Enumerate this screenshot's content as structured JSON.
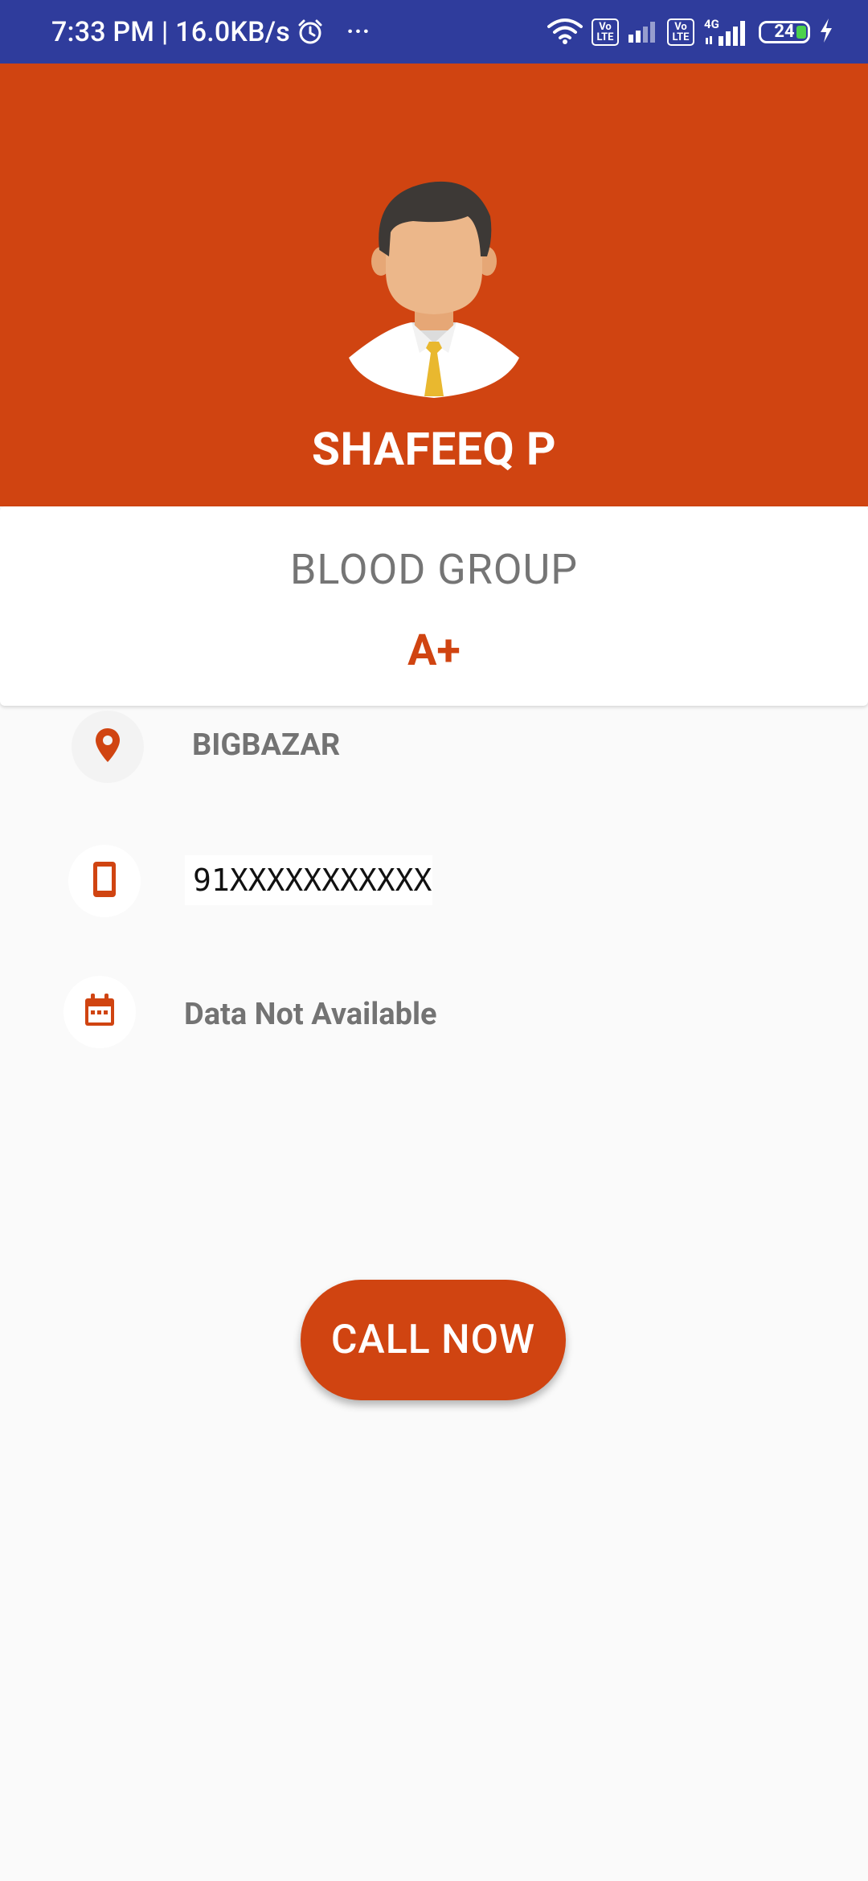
{
  "status_bar": {
    "time_speed": "7:33 PM | 16.0KB/s",
    "more": "···",
    "network_badge": [
      "Vo",
      "LTE"
    ],
    "network_4g": "4G",
    "battery_level": "24"
  },
  "profile": {
    "name": "SHAFEEQ P",
    "blood_group_label": "BLOOD GROUP",
    "blood_group_value": "A+"
  },
  "details": {
    "location": "BIGBAZAR",
    "phone": "91XXXXXXXXXXX",
    "date": "Data Not Available"
  },
  "actions": {
    "call_label": "CALL NOW"
  },
  "colors": {
    "status_bar": "#2f3c9c",
    "accent": "#d04411",
    "background": "#fafafa",
    "muted_text": "#757575"
  },
  "icons": {
    "location": "location-pin-icon",
    "phone": "smartphone-icon",
    "date": "calendar-icon"
  }
}
